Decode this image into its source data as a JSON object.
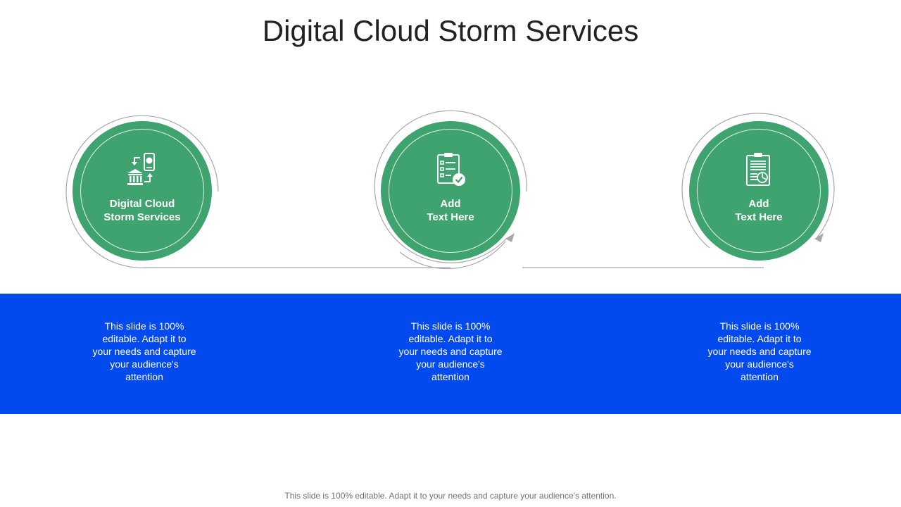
{
  "title": "Digital Cloud Storm Services",
  "colors": {
    "circle": "#3ea36e",
    "band": "#0249ee",
    "connector": "#a8a8a8"
  },
  "steps": [
    {
      "label": "Digital Cloud\nStorm Services",
      "icon": "bank-mobile-transfer-icon",
      "description": "This slide is 100% editable. Adapt it to your needs and capture your audience's attention"
    },
    {
      "label": "Add\nText Here",
      "icon": "clipboard-checklist-icon",
      "description": "This slide is 100% editable. Adapt it to your needs and capture your audience's attention"
    },
    {
      "label": "Add\nText Here",
      "icon": "report-pie-chart-icon",
      "description": "This slide is 100% editable. Adapt it to your needs and capture your audience's attention"
    }
  ],
  "footer": "This slide is 100% editable. Adapt it to your needs and capture your audience's attention."
}
